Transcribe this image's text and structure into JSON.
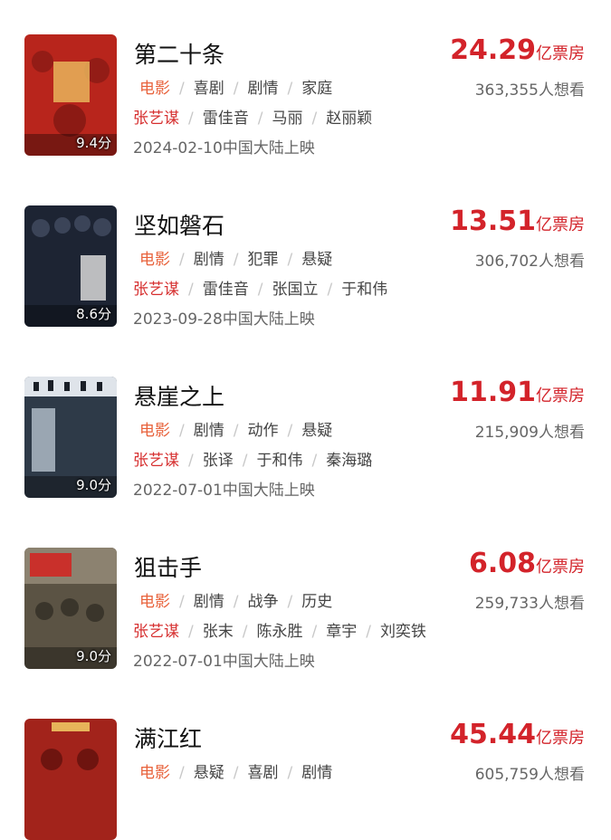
{
  "movies": [
    {
      "title": "第二十条",
      "score": "9.4分",
      "type": "电影",
      "genres": [
        "喜剧",
        "剧情",
        "家庭"
      ],
      "director": "张艺谋",
      "cast": [
        "雷佳音",
        "马丽",
        "赵丽颖"
      ],
      "release": "2024-02-10中国大陆上映",
      "box_office": "24.29",
      "box_unit": "亿票房",
      "want": "363,355人想看",
      "poster_color": "#b8251c"
    },
    {
      "title": "坚如磐石",
      "score": "8.6分",
      "type": "电影",
      "genres": [
        "剧情",
        "犯罪",
        "悬疑"
      ],
      "director": "张艺谋",
      "cast": [
        "雷佳音",
        "张国立",
        "于和伟"
      ],
      "release": "2023-09-28中国大陆上映",
      "box_office": "13.51",
      "box_unit": "亿票房",
      "want": "306,702人想看",
      "poster_color": "#1d2433"
    },
    {
      "title": "悬崖之上",
      "score": "9.0分",
      "type": "电影",
      "genres": [
        "剧情",
        "动作",
        "悬疑"
      ],
      "director": "张艺谋",
      "cast": [
        "张译",
        "于和伟",
        "秦海璐"
      ],
      "release": "2022-07-01中国大陆上映",
      "box_office": "11.91",
      "box_unit": "亿票房",
      "want": "215,909人想看",
      "poster_color": "#2e3a48"
    },
    {
      "title": "狙击手",
      "score": "9.0分",
      "type": "电影",
      "genres": [
        "剧情",
        "战争",
        "历史"
      ],
      "director": "张艺谋",
      "cast": [
        "张末",
        "陈永胜",
        "章宇",
        "刘奕铁"
      ],
      "release": "2022-07-01中国大陆上映",
      "box_office": "6.08",
      "box_unit": "亿票房",
      "want": "259,733人想看",
      "poster_color": "#5b5344"
    },
    {
      "title": "满江红",
      "score": "",
      "type": "电影",
      "genres": [
        "悬疑",
        "喜剧",
        "剧情"
      ],
      "director": "",
      "cast": [],
      "release": "",
      "box_office": "45.44",
      "box_unit": "亿票房",
      "want": "605,759人想看",
      "poster_color": "#a2231b"
    }
  ]
}
